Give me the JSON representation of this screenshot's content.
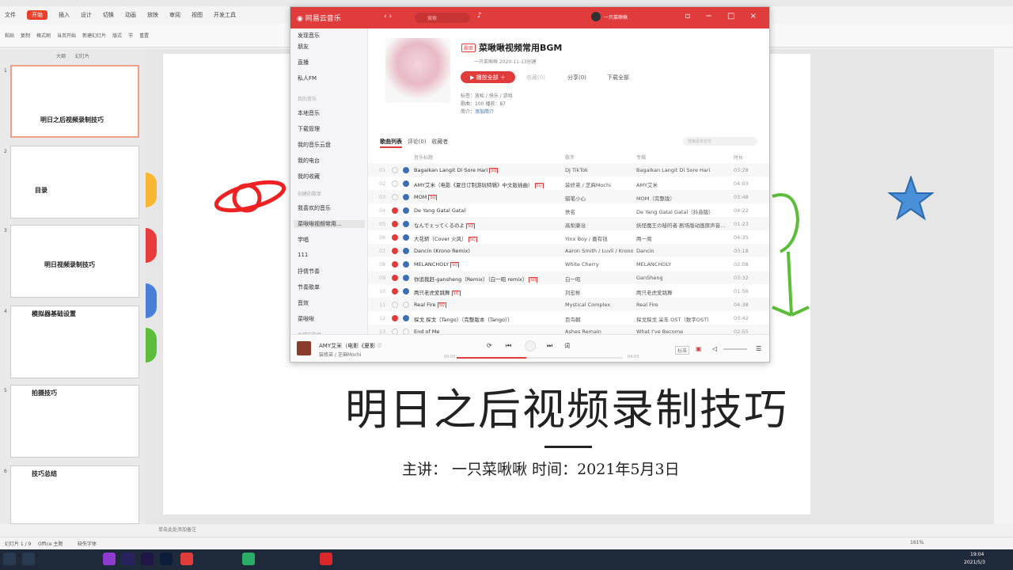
{
  "wps": {
    "tabs": [
      "文件",
      "开始",
      "插入",
      "设计",
      "切换",
      "动画",
      "放映",
      "审阅",
      "视图",
      "开发工具"
    ],
    "active_tab": "开始",
    "ribbon": [
      "粘贴",
      "复制",
      "格式刷",
      "当页开始",
      "新建幻灯片",
      "版式",
      "节",
      "重置"
    ],
    "panel_tabs": [
      "大纲",
      "幻灯片"
    ],
    "thumbs": [
      {
        "num": "1",
        "title": "明日之后视频录制技巧"
      },
      {
        "num": "2",
        "title": "目录"
      },
      {
        "num": "3",
        "title": "明日视频录制技巧"
      },
      {
        "num": "4",
        "title": "模拟器基础设置"
      },
      {
        "num": "5",
        "title": "拍摄技巧"
      },
      {
        "num": "6",
        "title": "技巧总结"
      }
    ],
    "slide": {
      "title": "明日之后视频录制技巧",
      "subtitle": "主讲：   一只菜啾啾       时间：2021年5月3日"
    },
    "notes": "单击此处添加备注",
    "status": {
      "slide_info": "幻灯片 1 / 9",
      "theme": "Office 主题",
      "font": "缺失字体",
      "zoom": "161%"
    },
    "clock": {
      "time": "19:04",
      "date": "2021/5/3"
    }
  },
  "music": {
    "app_name": "网易云音乐",
    "search_placeholder": "搜索",
    "user": "一只菜啾啾",
    "nav": [
      "发现音乐",
      "朋友",
      "直播",
      "私人FM"
    ],
    "group_my": "我的音乐",
    "my_items": [
      "本地音乐",
      "下载管理",
      "我的音乐云盘",
      "我的电台",
      "我的收藏"
    ],
    "group_created": "创建的歌单",
    "created": [
      "我喜欢的音乐",
      "菜啾啾视频常用...",
      "学唱",
      "111",
      "抒情节奏",
      "节奏歌单",
      "音效",
      "菜啾啾"
    ],
    "group_fav": "收藏的歌单",
    "playlist": {
      "tag": "歌单",
      "title": "菜啾啾视频常用BGM",
      "creator": "一只菜啾啾   2020-11-13创建",
      "play_all": "播放全部",
      "collect": "收藏(0)",
      "share": "分享(0)",
      "download": "下载全部",
      "labels": "标签：放松 / 快乐 / 游戏",
      "counts": "歌曲：100   播放：87",
      "intro_label": "简介：",
      "intro_link": "添加简介"
    },
    "tabs": [
      "歌曲列表",
      "评论(0)",
      "收藏者"
    ],
    "search_in_list": "搜索歌单音乐",
    "columns": {
      "title": "音乐标题",
      "artist": "歌手",
      "album": "专辑",
      "time": "时长"
    },
    "songs": [
      {
        "num": "01",
        "title": "Bagaikan Langit Di Sore Hari",
        "tag": "SQ",
        "artist": "DJ TikTok",
        "album": "Bagaikan Langit Di Sore Hari",
        "time": "03:28",
        "liked": false
      },
      {
        "num": "02",
        "title": "AMY艾米（电影《夏日订制游玩特辑》中文版插曲）",
        "tag": "SQ",
        "artist": "装修弟 / 芝麻Mochi",
        "album": "AMY艾米",
        "time": "04:03",
        "liked": false
      },
      {
        "num": "03",
        "title": "MOM",
        "tag": "SQ",
        "artist": "蜡笔小心",
        "album": "MOM（完整版）",
        "time": "03:48",
        "liked": false
      },
      {
        "num": "04",
        "title": "De Yang Gatal Gatal",
        "tag": "",
        "artist": "佚名",
        "album": "De Yang Gatal Gatal（抖音版）",
        "time": "04:22",
        "liked": true
      },
      {
        "num": "05",
        "title": "なんでぇってくるのよ",
        "tag": "SQ",
        "artist": "高梨康治",
        "album": "妖怪魔王の秘的者 剧场版动画原声音...",
        "time": "01:23",
        "liked": true
      },
      {
        "num": "06",
        "title": "大花轿（Cover 火风）",
        "tag": "SQ",
        "artist": "Yinx Boy / 嘉有钱",
        "album": "两一周",
        "time": "04:35",
        "liked": true
      },
      {
        "num": "07",
        "title": "Dancin (Krono Remix)",
        "tag": "",
        "artist": "Aaron Smith / Luvli / Krono",
        "album": "Dancin",
        "time": "03:18",
        "liked": true
      },
      {
        "num": "08",
        "title": "MELANCHOLY",
        "tag": "SQ",
        "artist": "White Cherry",
        "album": "MELANCHOLY",
        "time": "02:08",
        "liked": true
      },
      {
        "num": "09",
        "title": "你追我赶-gansheng（Remix）（白一昭 remix）",
        "tag": "SQ",
        "artist": "白一昭",
        "album": "GanSheng",
        "time": "03:32",
        "liked": true
      },
      {
        "num": "10",
        "title": "两只老虎爱跳舞",
        "tag": "SQ",
        "artist": "刘宏彬",
        "album": "两只老虎爱跳舞",
        "time": "01:56",
        "liked": true
      },
      {
        "num": "11",
        "title": "Real Fire",
        "tag": "SQ",
        "artist": "Mystical Complex",
        "album": "Real Fire",
        "time": "04:38",
        "liked": false
      },
      {
        "num": "12",
        "title": "探戈 探戈（Tango）（完整版本（Tango））",
        "tag": "",
        "artist": "百鸟朝",
        "album": "探戈探戈 采车 OST（数字OST）",
        "time": "03:42",
        "liked": true
      },
      {
        "num": "13",
        "title": "End of Me",
        "tag": "",
        "artist": "Ashes Remain",
        "album": "What I've Become",
        "time": "02:55",
        "liked": false
      }
    ],
    "now_playing": {
      "title": "AMY艾米（电影《夏影",
      "artist": "装修弟 / 芝麻Mochi",
      "elapsed": "00:00",
      "duration": "04:03",
      "progress": 0.42,
      "lyric_btn": "词",
      "quality": "标准"
    }
  },
  "colors": {
    "brand": "#e13c3c",
    "link": "#3a6fb5"
  }
}
